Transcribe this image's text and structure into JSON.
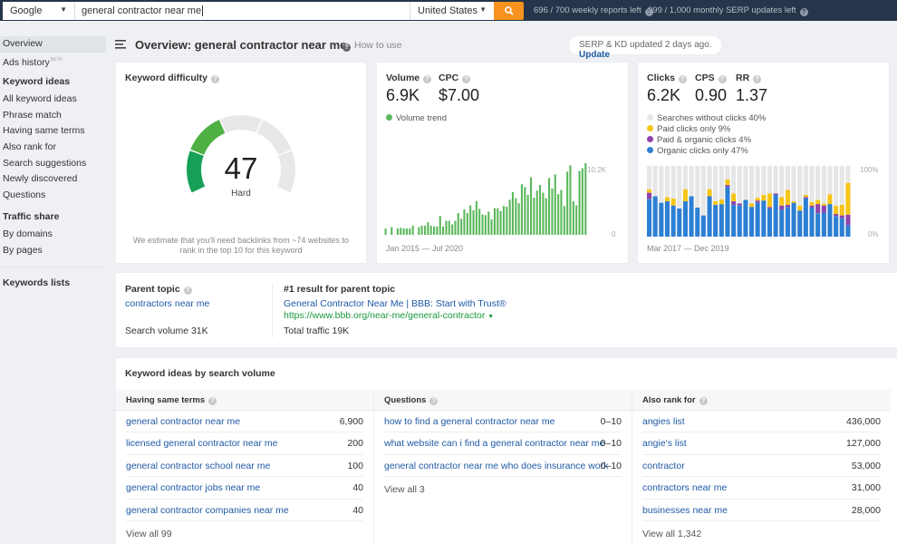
{
  "topbar": {
    "engine": "Google",
    "search_value": "general contractor near me",
    "country": "United States",
    "weekly_reports": "696 / 700 weekly reports left",
    "monthly_serp": "999 / 1,000 monthly SERP updates left"
  },
  "sidebar": {
    "overview": "Overview",
    "ads_history": "Ads history",
    "ads_badge": "BETA",
    "keyword_ideas_head": "Keyword ideas",
    "keyword_ideas": [
      "All keyword ideas",
      "Phrase match",
      "Having same terms",
      "Also rank for",
      "Search suggestions",
      "Newly discovered",
      "Questions"
    ],
    "traffic_share_head": "Traffic share",
    "traffic_share": [
      "By domains",
      "By pages"
    ],
    "keywords_lists": "Keywords lists"
  },
  "header": {
    "title": "Overview: general contractor near me",
    "how_to_use": "How to use",
    "update_text": "SERP & KD updated 2 days ago.",
    "update_link": "Update"
  },
  "kd": {
    "title": "Keyword difficulty",
    "score": "47",
    "score_value": 47,
    "label": "Hard",
    "note": "We estimate that you'll need backlinks from ~74 websites to rank in the top 10 for this keyword",
    "colors": {
      "green_dark": "#1aa35b",
      "green": "#5cb840",
      "yellow": "#c8c21a",
      "empty": "#e8e8e8"
    }
  },
  "volume": {
    "volume_label": "Volume",
    "volume_value": "6.9K",
    "cpc_label": "CPC",
    "cpc_value": "$7.00",
    "legend": "Volume trend",
    "color": "#5cb85c",
    "y_max_label": "10.2K",
    "y_min_label": "0",
    "range": "Jan 2015 — Jul 2020"
  },
  "clicks": {
    "clicks_label": "Clicks",
    "clicks_value": "6.2K",
    "cps_label": "CPS",
    "cps_value": "0.90",
    "rr_label": "RR",
    "rr_value": "1.37",
    "legend": [
      {
        "label": "Searches without clicks 40%",
        "color": "#e6e6e6"
      },
      {
        "label": "Paid clicks only 9%",
        "color": "#f5c518"
      },
      {
        "label": "Paid & organic clicks 4%",
        "color": "#8e44ad"
      },
      {
        "label": "Organic clicks only 47%",
        "color": "#2d7fd3"
      }
    ],
    "y_max_label": "100%",
    "y_min_label": "0%",
    "range": "Mar 2017 — Dec 2019"
  },
  "parent_topic": {
    "title": "Parent topic",
    "topic": "contractors near me",
    "search_volume": "Search volume 31K",
    "result_title": "#1 result for parent topic",
    "result_link": "General Contractor Near Me | BBB: Start with Trust®",
    "result_url": "https://www.bbb.org/near-me/general-contractor",
    "total_traffic": "Total traffic 19K"
  },
  "keyword_ideas": {
    "title": "Keyword ideas by search volume",
    "columns": [
      {
        "head": "Having same terms",
        "rows": [
          {
            "kw": "general contractor near me",
            "val": "6,900"
          },
          {
            "kw": "licensed general contractor near me",
            "val": "200"
          },
          {
            "kw": "general contractor school near me",
            "val": "100"
          },
          {
            "kw": "general contractor jobs near me",
            "val": "40"
          },
          {
            "kw": "general contractor companies near me",
            "val": "40"
          }
        ],
        "view_all": "View all 99"
      },
      {
        "head": "Questions",
        "rows": [
          {
            "kw": "how to find a general contractor near me",
            "val": "0–10"
          },
          {
            "kw": "what website can i find a general contractor near me",
            "val": "0–10"
          },
          {
            "kw": "general contractor near me who does insurance work",
            "val": "0–10"
          }
        ],
        "view_all": "View all 3"
      },
      {
        "head": "Also rank for",
        "rows": [
          {
            "kw": "angies list",
            "val": "436,000"
          },
          {
            "kw": "angie's list",
            "val": "127,000"
          },
          {
            "kw": "contractor",
            "val": "53,000"
          },
          {
            "kw": "contractors near me",
            "val": "31,000"
          },
          {
            "kw": "businesses near me",
            "val": "28,000"
          }
        ],
        "view_all": "View all 1,342"
      }
    ]
  },
  "chart_data": [
    {
      "type": "bar",
      "title": "Volume trend",
      "xlabel": "Jan 2015 — Jul 2020",
      "ylabel": "",
      "ylim": [
        0,
        10200
      ],
      "tick_labels": [
        "0",
        "10.2K"
      ],
      "values": [
        900,
        0,
        1100,
        0,
        900,
        1000,
        900,
        900,
        900,
        1300,
        0,
        1100,
        1300,
        1300,
        1800,
        1300,
        1200,
        1200,
        2700,
        1200,
        2000,
        2000,
        1500,
        2000,
        3100,
        2300,
        3600,
        3100,
        4200,
        3500,
        4800,
        3700,
        2900,
        2800,
        3300,
        2200,
        3800,
        3800,
        3400,
        4100,
        4000,
        5000,
        6100,
        5200,
        4500,
        7200,
        6800,
        5700,
        8200,
        5300,
        6300,
        7100,
        6000,
        5200,
        8100,
        6600,
        8600,
        5800,
        6400,
        4100,
        9000,
        9900,
        4800,
        4200,
        9100,
        9500,
        10200
      ]
    },
    {
      "type": "bar",
      "stacked": true,
      "title": "Clicks distribution",
      "xlabel": "Mar 2017 — Dec 2019",
      "ylim": [
        0,
        100
      ],
      "tick_labels": [
        "0%",
        "100%"
      ],
      "series": [
        {
          "name": "Organic clicks only",
          "values": [
            53,
            57,
            48,
            50,
            44,
            40,
            50,
            57,
            41,
            30,
            57,
            45,
            46,
            70,
            45,
            44,
            52,
            42,
            48,
            51,
            40,
            59,
            38,
            42,
            48,
            37,
            54,
            41,
            33,
            34,
            46,
            29,
            26,
            16
          ]
        },
        {
          "name": "Paid & organic clicks",
          "values": [
            9,
            0,
            0,
            0,
            0,
            0,
            0,
            0,
            0,
            0,
            0,
            0,
            0,
            3,
            5,
            3,
            0,
            0,
            3,
            0,
            2,
            2,
            6,
            3,
            0,
            0,
            2,
            3,
            13,
            10,
            0,
            3,
            4,
            15
          ]
        },
        {
          "name": "Paid clicks only",
          "values": [
            5,
            0,
            0,
            6,
            10,
            0,
            17,
            0,
            0,
            0,
            10,
            5,
            7,
            8,
            11,
            0,
            0,
            5,
            4,
            8,
            19,
            0,
            12,
            21,
            2,
            7,
            3,
            5,
            6,
            3,
            14,
            12,
            15,
            45
          ]
        },
        {
          "name": "Searches without clicks",
          "values": [
            33,
            43,
            52,
            44,
            46,
            60,
            33,
            43,
            59,
            70,
            33,
            50,
            47,
            19,
            39,
            53,
            48,
            53,
            45,
            41,
            39,
            39,
            44,
            34,
            50,
            56,
            41,
            51,
            48,
            53,
            40,
            56,
            55,
            24
          ]
        }
      ]
    }
  ]
}
